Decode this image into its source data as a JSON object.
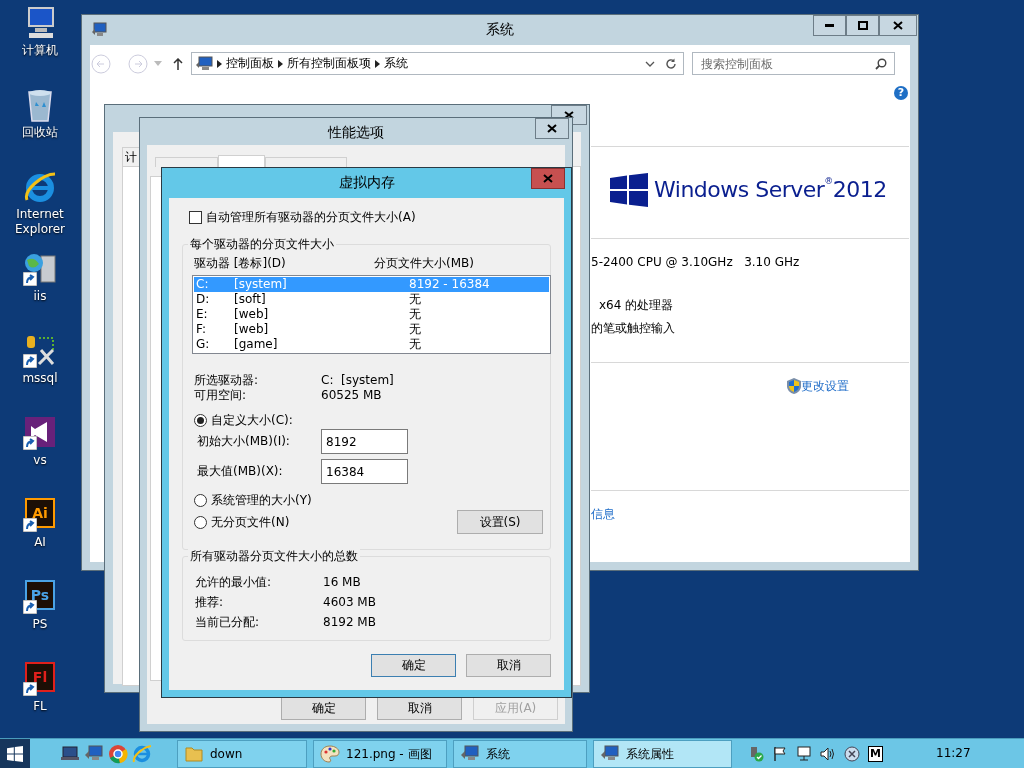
{
  "desktop_icons": [
    {
      "label": "计算机",
      "kind": "computer"
    },
    {
      "label": "回收站",
      "kind": "bin"
    },
    {
      "label": "Internet Explorer",
      "kind": "ie"
    },
    {
      "label": "iis",
      "kind": "server"
    },
    {
      "label": "mssql",
      "kind": "tools"
    },
    {
      "label": "vs",
      "kind": "vs"
    },
    {
      "label": "AI",
      "kind": "letter",
      "glyph": "Ai",
      "color": "#ff9a00"
    },
    {
      "label": "PS",
      "kind": "letter",
      "glyph": "Ps",
      "color": "#4aa3e6"
    },
    {
      "label": "FL",
      "kind": "letter",
      "glyph": "Fl",
      "color": "#e0201c"
    }
  ],
  "system_window": {
    "title": "系统",
    "breadcrumb": [
      "控制面板",
      "所有控制面板项",
      "系统"
    ],
    "search": {
      "placeholder": "搜索控制面板"
    },
    "help_glyph": "?",
    "logo": "Windows Server$^{®}$2012",
    "cpu_text": "5-2400 CPU @ 3.10GHz   3.10 GHz",
    "system_type_text": "x64 的处理器",
    "pen_text": "的笔或触控输入",
    "change_settings_link": "更改设置",
    "info_link": "信息"
  },
  "system_properties": {
    "tabs": [
      {
        "label": "计",
        "selected": false
      }
    ]
  },
  "performance_options": {
    "title": "性能选项",
    "tabs": [
      {
        "selected": false
      },
      {
        "selected": true
      },
      {
        "selected": false
      }
    ],
    "buttons": [
      {
        "label": "确定",
        "disabled": false
      },
      {
        "label": "取消",
        "disabled": false
      },
      {
        "label": "应用(A)",
        "disabled": true
      }
    ]
  },
  "virtual_memory": {
    "title": "虚拟内存",
    "auto_manage": {
      "label": "自动管理所有驱动器的分页文件大小(A)",
      "checked": false
    },
    "per_drive_group": "每个驱动器的分页文件大小",
    "columns": [
      "驱动器 [卷标](D)",
      "分页文件大小(MB)"
    ],
    "drives": [
      {
        "drive": "C:",
        "label": "[system]",
        "size": "8192 - 16384",
        "selected": true
      },
      {
        "drive": "D:",
        "label": "[soft]",
        "size": "无",
        "selected": false
      },
      {
        "drive": "E:",
        "label": "[web]",
        "size": "无",
        "selected": false
      },
      {
        "drive": "F:",
        "label": "[web]",
        "size": "无",
        "selected": false
      },
      {
        "drive": "G:",
        "label": "[game]",
        "size": "无",
        "selected": false
      }
    ],
    "selected_drive": {
      "label": "所选驱动器:",
      "value": "C:  [system]"
    },
    "free_space": {
      "label": "可用空间:",
      "value": "60525 MB"
    },
    "options": [
      {
        "label": "自定义大小(C):",
        "selected": true
      },
      {
        "label": "系统管理的大小(Y)",
        "selected": false
      },
      {
        "label": "无分页文件(N)",
        "selected": false
      }
    ],
    "initial_size": {
      "label": "初始大小(MB)(I):",
      "value": "8192"
    },
    "maximum_size": {
      "label": "最大值(MB)(X):",
      "value": "16384"
    },
    "set_button": "设置(S)",
    "totals_group": "所有驱动器分页文件大小的总数",
    "totals": [
      {
        "label": "允许的最小值:",
        "value": "16 MB"
      },
      {
        "label": "推荐:",
        "value": "4603 MB"
      },
      {
        "label": "当前已分配:",
        "value": "8192 MB"
      }
    ],
    "buttons": [
      {
        "label": "确定",
        "default": true
      },
      {
        "label": "取消",
        "default": false
      }
    ]
  },
  "taskbar": {
    "quick_launch": [
      {
        "kind": "laptop"
      },
      {
        "kind": "monitor"
      },
      {
        "kind": "chrome"
      },
      {
        "kind": "ie"
      }
    ],
    "items": [
      {
        "label": "down",
        "kind": "folder",
        "selected": false
      },
      {
        "label": "121.png - 画图",
        "kind": "paint",
        "selected": false
      },
      {
        "label": "系统",
        "kind": "monitor",
        "selected": false
      },
      {
        "label": "系统属性",
        "kind": "monitor",
        "selected": true
      }
    ],
    "tray_letter": "M",
    "clock": "11:27"
  }
}
